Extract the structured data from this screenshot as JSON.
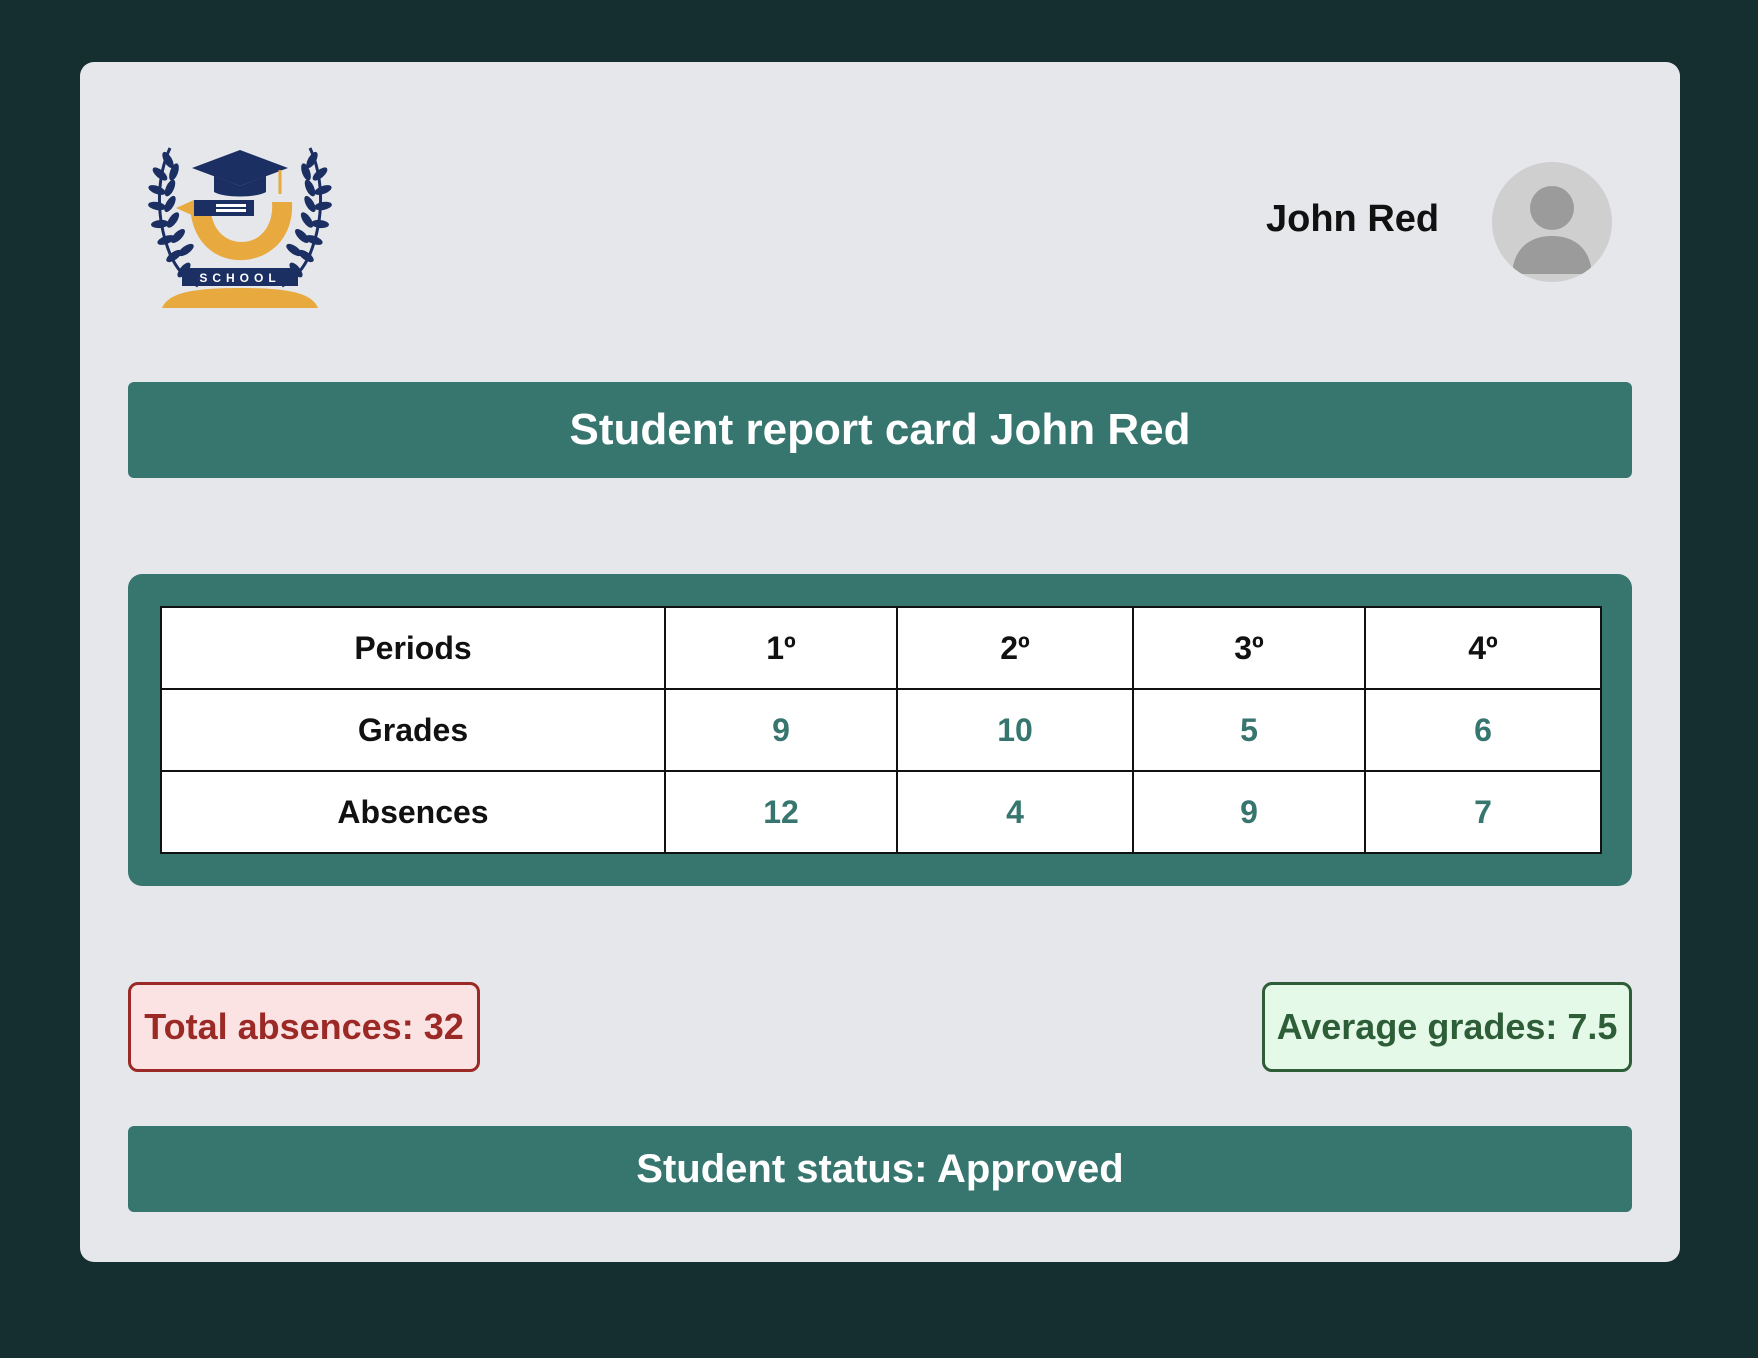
{
  "header": {
    "logo_text": "SCHOOL",
    "student_name": "John Red"
  },
  "title": "Student report card John Red",
  "table": {
    "header_label": "Periods",
    "periods": [
      "1º",
      "2º",
      "3º",
      "4º"
    ],
    "rows": [
      {
        "label": "Grades",
        "values": [
          "9",
          "10",
          "5",
          "6"
        ]
      },
      {
        "label": "Absences",
        "values": [
          "12",
          "4",
          "9",
          "7"
        ]
      }
    ]
  },
  "summary": {
    "total_absences": "Total absences: 32",
    "average_grades": "Average grades: 7.5"
  },
  "status": "Student status: Approved",
  "colors": {
    "page_background": "#152e30",
    "card_background": "#e5e7eb",
    "accent": "#37756f",
    "absence_text": "#9b2a26",
    "absence_bg": "#fbe3e3",
    "average_text": "#2d5e37",
    "average_bg": "#e4f9e8",
    "logo_navy": "#1b2f63",
    "logo_gold": "#e8a93f"
  },
  "icons": {
    "logo": "school-logo-icon",
    "avatar": "user-avatar-icon"
  }
}
